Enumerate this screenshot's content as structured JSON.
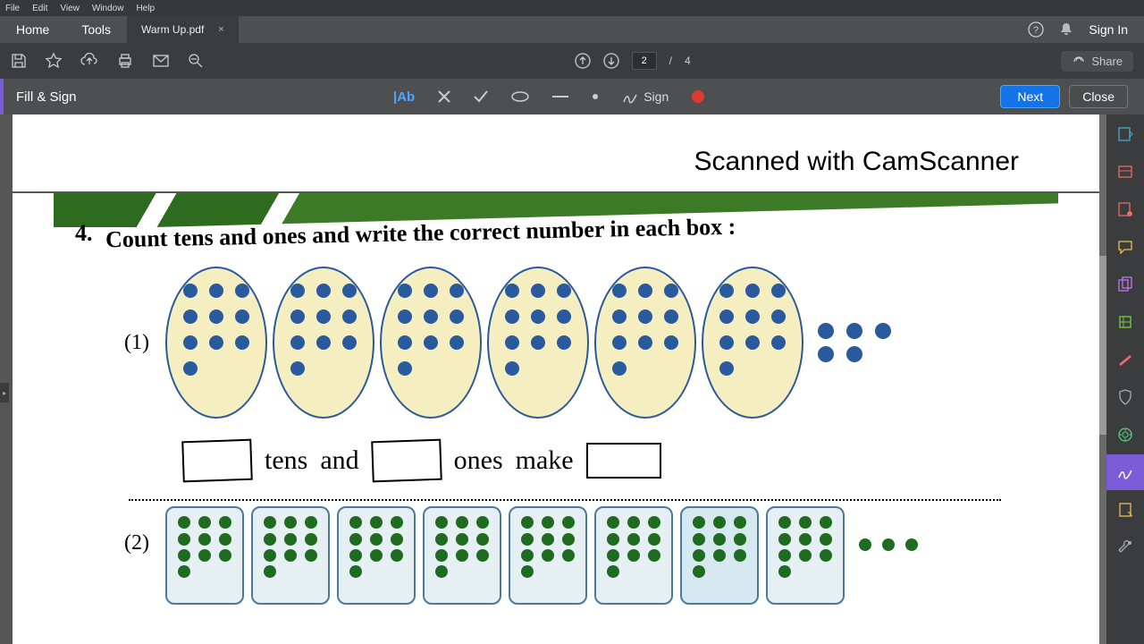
{
  "menu": {
    "file": "File",
    "edit": "Edit",
    "view": "View",
    "window": "Window",
    "help": "Help"
  },
  "tabs": {
    "home": "Home",
    "tools": "Tools",
    "doc": "Warm Up.pdf",
    "close": "×"
  },
  "signin": "Sign In",
  "pagenav": {
    "up": "↑",
    "down": "↓",
    "current": "2",
    "sep": "/",
    "total": "4"
  },
  "share": "Share",
  "fillsign": "Fill & Sign",
  "signtool": "Sign",
  "btn": {
    "next": "Next",
    "close": "Close"
  },
  "watermark": "Scanned with CamScanner",
  "q": {
    "num": "4.",
    "text": "Count tens and ones and write the correct number in each box :",
    "sub1": "(1)",
    "sub2": "(2)",
    "tens": "tens",
    "and": "and",
    "ones": "ones",
    "make": "make"
  }
}
